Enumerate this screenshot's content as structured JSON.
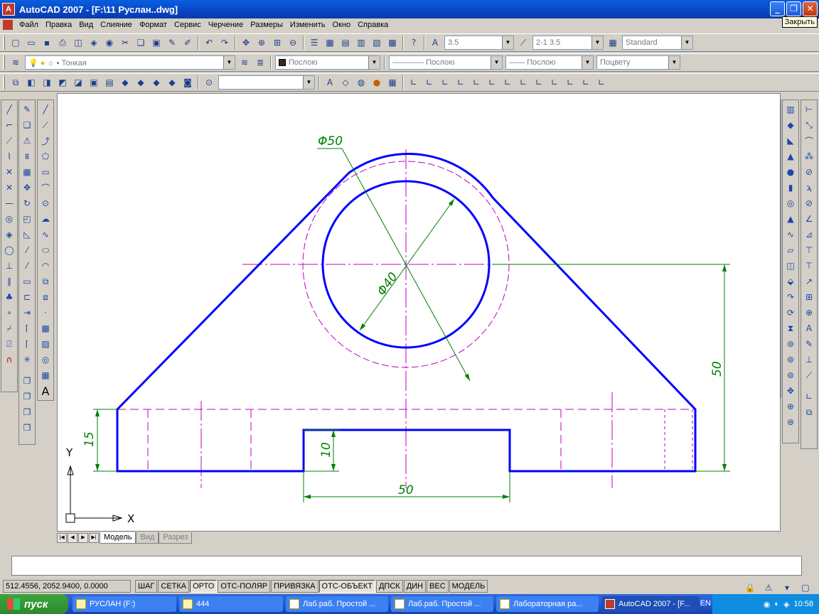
{
  "window": {
    "title": "AutoCAD 2007 - [F:\\11 Руслан..dwg]",
    "close_tooltip": "Закрыть"
  },
  "menu": {
    "items": [
      "Файл",
      "Правка",
      "Вид",
      "Слияние",
      "Формат",
      "Сервис",
      "Черчение",
      "Размеры",
      "Изменить",
      "Окно",
      "Справка"
    ]
  },
  "toolbar_styles": {
    "text_height": "3.5",
    "dim_style": "2-1 3.5",
    "table_style": "Standard"
  },
  "toolbar_layers": {
    "layer": "Тонкая",
    "color": "Послою",
    "linetype": "Послою",
    "lineweight": "Послою",
    "plotstyle": "Поцвету"
  },
  "drawing": {
    "dim_circle_outer": "Φ50",
    "dim_circle_inner": "Φ40",
    "dim_height_right": "50",
    "dim_base_width": "50",
    "dim_base_left": "15",
    "dim_slot": "10",
    "ucs_x": "X",
    "ucs_y": "Y"
  },
  "tabs": [
    "Модель",
    "Вид",
    "Разрез"
  ],
  "status": {
    "coords": "512.4556, 2052.9400, 0.0000",
    "buttons": [
      "ШАГ",
      "СЕТКА",
      "ОРТО",
      "ОТС-ПОЛЯР",
      "ПРИВЯЗКА",
      "ОТС-ОБЪЕКТ",
      "ДПСК",
      "ДИН",
      "ВЕС",
      "МОДЕЛЬ"
    ]
  },
  "taskbar": {
    "start": "пуск",
    "tasks": [
      "РУСЛАН (F:)",
      "444",
      "Лаб.раб. Простой ...",
      "Лаб.раб. Простой ...",
      "Лабораторная ра...",
      "AutoCAD 2007 - [F..."
    ],
    "lang": "EN",
    "clock": "10:58"
  },
  "colors": {
    "object": "#0000ff",
    "centerline": "#c000c0",
    "dimension": "#008000"
  }
}
